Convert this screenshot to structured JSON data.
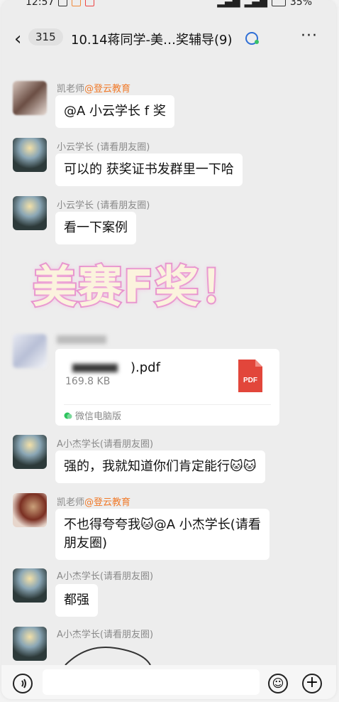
{
  "status_bar": {
    "time": "12:57",
    "battery": "35%"
  },
  "header": {
    "back_icon": "‹",
    "unread_count": "315",
    "title": "10.14蒋同学-美…奖辅导(9)",
    "more_icon": "···"
  },
  "messages": [
    {
      "sender": "凯老师",
      "org": "@登云教育",
      "text": "@A 小云学长 f 奖"
    },
    {
      "sender": "小云学长 (请看朋友圈)",
      "text": "可以的 获奖证书发群里一下哈"
    },
    {
      "sender": "小云学长 (请看朋友圈)",
      "text": "看一下案例"
    },
    {
      "file": {
        "name_suffix": ").pdf",
        "size": "169.8 KB",
        "source": "微信电脑版",
        "icon_label": "PDF"
      }
    },
    {
      "sender": "A小杰学长(请看朋友圈)",
      "text": "强的，我就知道你们肯定能行🐱🐱"
    },
    {
      "sender": "凯老师",
      "org": "@登云教育",
      "text_line1": "不也得夸夸我🐱@A 小杰学长(请看",
      "text_line2": "朋友圈)"
    },
    {
      "sender": "A小杰学长(请看朋友圈)",
      "text": "都强"
    },
    {
      "sender": "A小杰学长(请看朋友圈)"
    }
  ],
  "overlay_text": "美赛F奖！",
  "colors": {
    "org_accent": "#f07a2a",
    "overlay_stroke": "#e58ecb",
    "pdf_red": "#e2463b"
  }
}
